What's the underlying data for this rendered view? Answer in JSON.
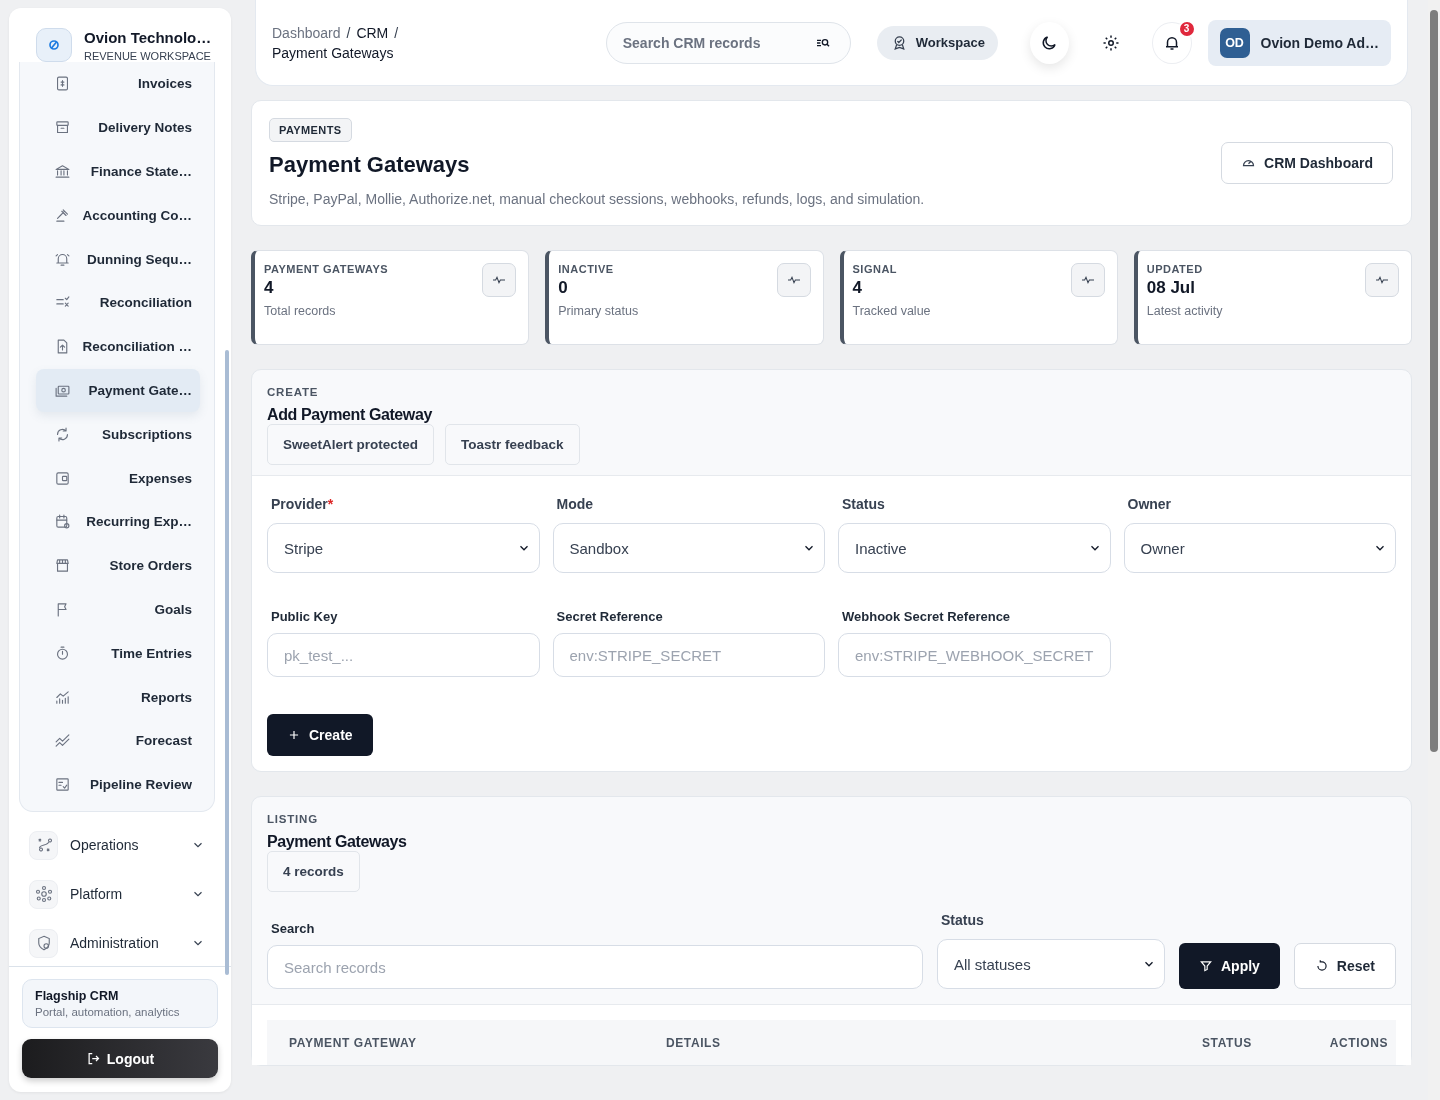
{
  "sidebar": {
    "brand": {
      "name": "Ovion Technolo…",
      "subtitle": "REVENUE WORKSPACE"
    },
    "items": [
      {
        "label": "Invoices",
        "selected": false
      },
      {
        "label": "Delivery Notes",
        "selected": false
      },
      {
        "label": "Finance State…",
        "selected": false
      },
      {
        "label": "Accounting Co…",
        "selected": false
      },
      {
        "label": "Dunning Sequ…",
        "selected": false
      },
      {
        "label": "Reconciliation",
        "selected": false
      },
      {
        "label": "Reconciliation …",
        "selected": false
      },
      {
        "label": "Payment Gate…",
        "selected": true
      },
      {
        "label": "Subscriptions",
        "selected": false
      },
      {
        "label": "Expenses",
        "selected": false
      },
      {
        "label": "Recurring Exp…",
        "selected": false
      },
      {
        "label": "Store Orders",
        "selected": false
      },
      {
        "label": "Goals",
        "selected": false
      },
      {
        "label": "Time Entries",
        "selected": false
      },
      {
        "label": "Reports",
        "selected": false
      },
      {
        "label": "Forecast",
        "selected": false
      },
      {
        "label": "Pipeline Review",
        "selected": false
      }
    ],
    "groups": [
      {
        "label": "Operations",
        "expanded": false
      },
      {
        "label": "Platform",
        "expanded": false
      },
      {
        "label": "Administration",
        "expanded": false
      }
    ],
    "promo": {
      "title": "Flagship CRM",
      "text": "Portal, automation, analytics"
    },
    "logout": "Logout"
  },
  "topbar": {
    "breadcrumb": [
      "Dashboard",
      "CRM",
      "Payment Gateways"
    ],
    "separator": "/",
    "search": {
      "placeholder": "Search CRM records"
    },
    "workspace": "Workspace",
    "notifications": "3",
    "user": {
      "initials": "OD",
      "name": "Ovion Demo Ad…"
    }
  },
  "header": {
    "badge": "PAYMENTS",
    "title": "Payment Gateways",
    "description": "Stripe, PayPal, Mollie, Authorize.net, manual checkout sessions, webhooks, refunds, logs, and simulation.",
    "action": "CRM Dashboard"
  },
  "stats": [
    {
      "label": "PAYMENT GATEWAYS",
      "value": "4",
      "caption": "Total records"
    },
    {
      "label": "INACTIVE",
      "value": "0",
      "caption": "Primary status"
    },
    {
      "label": "SIGNAL",
      "value": "4",
      "caption": "Tracked value"
    },
    {
      "label": "UPDATED",
      "value": "08 Jul",
      "caption": "Latest activity"
    }
  ],
  "create": {
    "eyebrow": "CREATE",
    "title": "Add Payment Gateway",
    "tags": [
      "SweetAlert protected",
      "Toastr feedback"
    ],
    "fields": [
      {
        "kind": "select",
        "label": "Provider",
        "required_mark": "*",
        "value": "Stripe"
      },
      {
        "kind": "select",
        "label": "Mode",
        "value": "Sandbox"
      },
      {
        "kind": "select",
        "label": "Status",
        "value": "Inactive"
      },
      {
        "kind": "select",
        "label": "Owner",
        "value": "Owner"
      },
      {
        "kind": "input",
        "label": "Public Key",
        "placeholder": "pk_test_..."
      },
      {
        "kind": "input",
        "label": "Secret Reference",
        "placeholder": "env:STRIPE_SECRET"
      },
      {
        "kind": "input",
        "label": "Webhook Secret Reference",
        "placeholder": "env:STRIPE_WEBHOOK_SECRET"
      }
    ],
    "submit": "Create"
  },
  "listing": {
    "eyebrow": "LISTING",
    "title": "Payment Gateways",
    "count": "4 records",
    "search": {
      "label": "Search",
      "placeholder": "Search records"
    },
    "status": {
      "label": "Status",
      "value": "All statuses"
    },
    "apply": "Apply",
    "reset": "Reset",
    "columns": [
      "PAYMENT GATEWAY",
      "DETAILS",
      "STATUS",
      "ACTIONS"
    ]
  }
}
